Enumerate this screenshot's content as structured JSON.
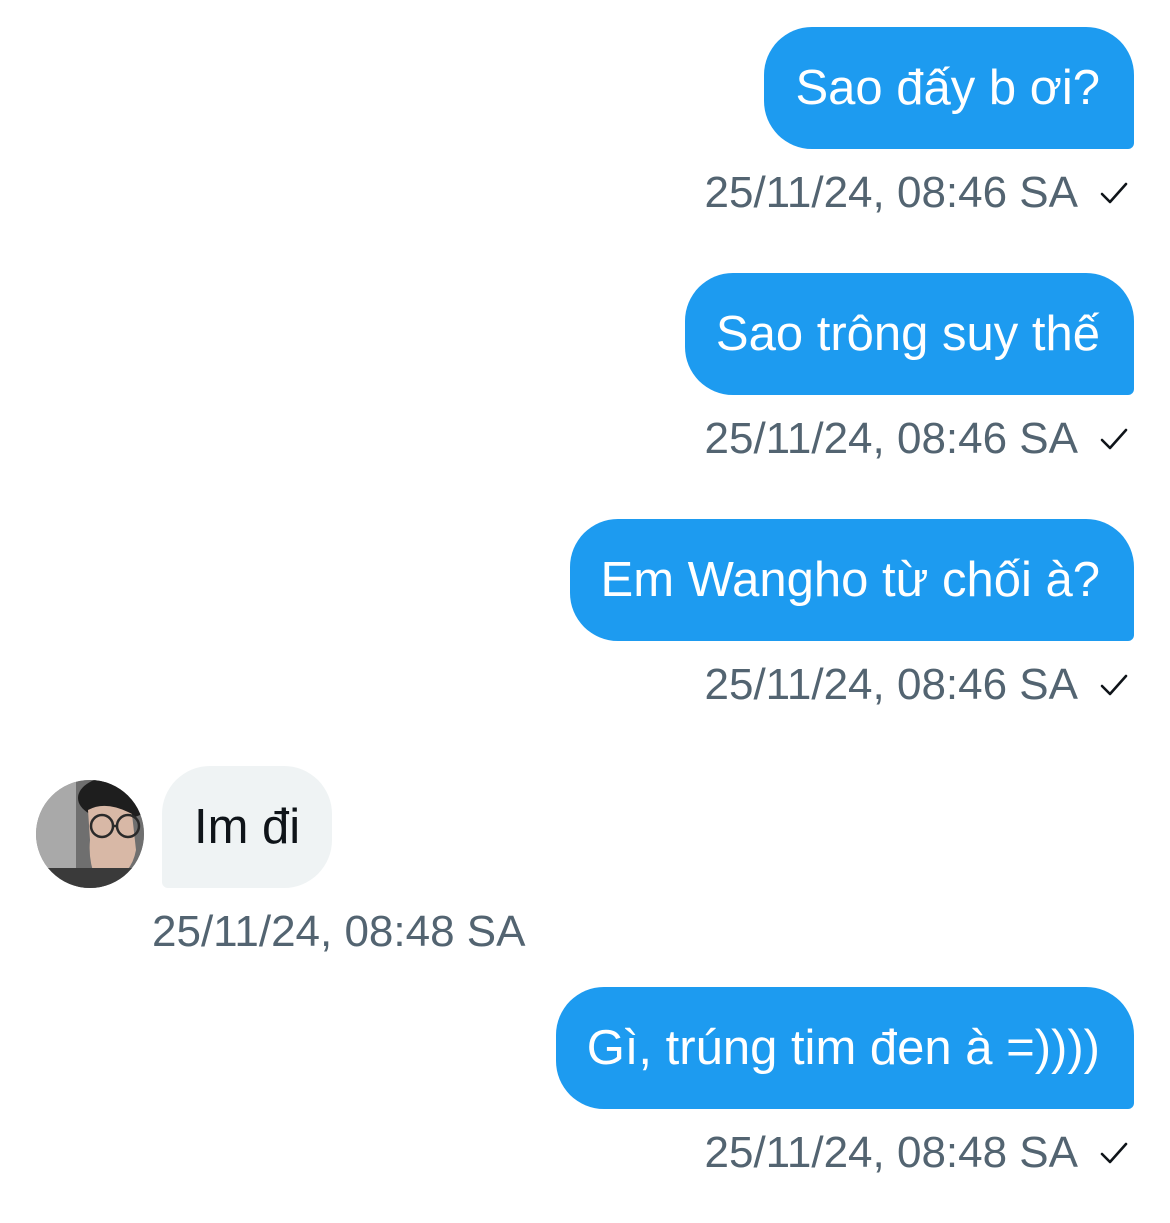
{
  "messages": [
    {
      "direction": "out",
      "text": "Sao đấy b ơi?",
      "timestamp": "25/11/24, 08:46 SA",
      "status_icon": "check-icon"
    },
    {
      "direction": "out",
      "text": "Sao trông suy thế",
      "timestamp": "25/11/24, 08:46 SA",
      "status_icon": "check-icon"
    },
    {
      "direction": "out",
      "text": "Em Wangho từ chối à?",
      "timestamp": "25/11/24, 08:46 SA",
      "status_icon": "check-icon"
    },
    {
      "direction": "in",
      "text": "Im đi",
      "timestamp": "25/11/24, 08:48 SA",
      "avatar_icon": "avatar"
    },
    {
      "direction": "out",
      "text": "Gì, trúng tim đen à =))))",
      "timestamp": "25/11/24, 08:48 SA",
      "status_icon": "check-icon"
    }
  ],
  "colors": {
    "outgoing_bubble": "#1d9bf0",
    "incoming_bubble": "#eff3f4",
    "timestamp_text": "#536471"
  }
}
